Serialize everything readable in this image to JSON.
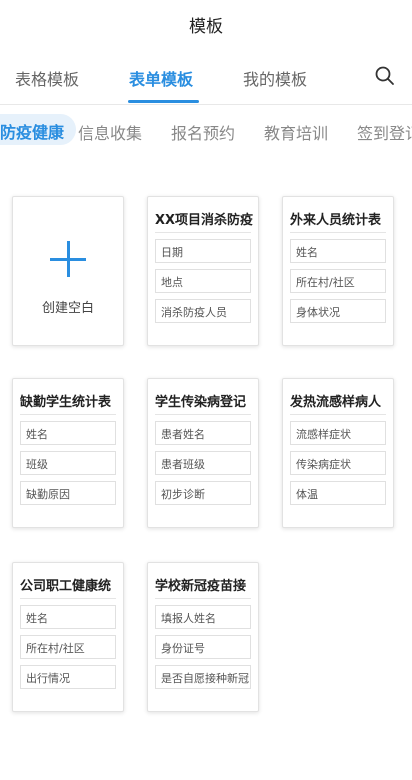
{
  "header": {
    "title": "模板"
  },
  "tabs": [
    {
      "label": "表格模板",
      "active": false
    },
    {
      "label": "表单模板",
      "active": true
    },
    {
      "label": "我的模板",
      "active": false
    }
  ],
  "search_icon": "search-icon",
  "categories": [
    {
      "label": "防疫健康",
      "active": true
    },
    {
      "label": "信息收集",
      "active": false
    },
    {
      "label": "报名预约",
      "active": false
    },
    {
      "label": "教育培训",
      "active": false
    },
    {
      "label": "签到登记",
      "active": false
    }
  ],
  "blank_card": {
    "icon": "plus-icon",
    "label": "创建空白"
  },
  "templates": [
    {
      "title": "XX项目消杀防疫",
      "fields": [
        "日期",
        "地点",
        "消杀防疫人员"
      ]
    },
    {
      "title": "外来人员统计表",
      "fields": [
        "姓名",
        "所在村/社区",
        "身体状况"
      ]
    },
    {
      "title": "缺勤学生统计表",
      "fields": [
        "姓名",
        "班级",
        "缺勤原因"
      ]
    },
    {
      "title": "学生传染病登记",
      "fields": [
        "患者姓名",
        "患者班级",
        "初步诊断"
      ]
    },
    {
      "title": "发热流感样病人",
      "fields": [
        "流感样症状",
        "传染病症状",
        "体温"
      ]
    },
    {
      "title": "公司职工健康统",
      "fields": [
        "姓名",
        "所在村/社区",
        "出行情况"
      ]
    },
    {
      "title": "学校新冠疫苗接",
      "fields": [
        "填报人姓名",
        "身份证号",
        "是否自愿接种新冠"
      ]
    }
  ],
  "colors": {
    "accent": "#2a8ee0",
    "accent_bg": "#e6f1fb"
  }
}
